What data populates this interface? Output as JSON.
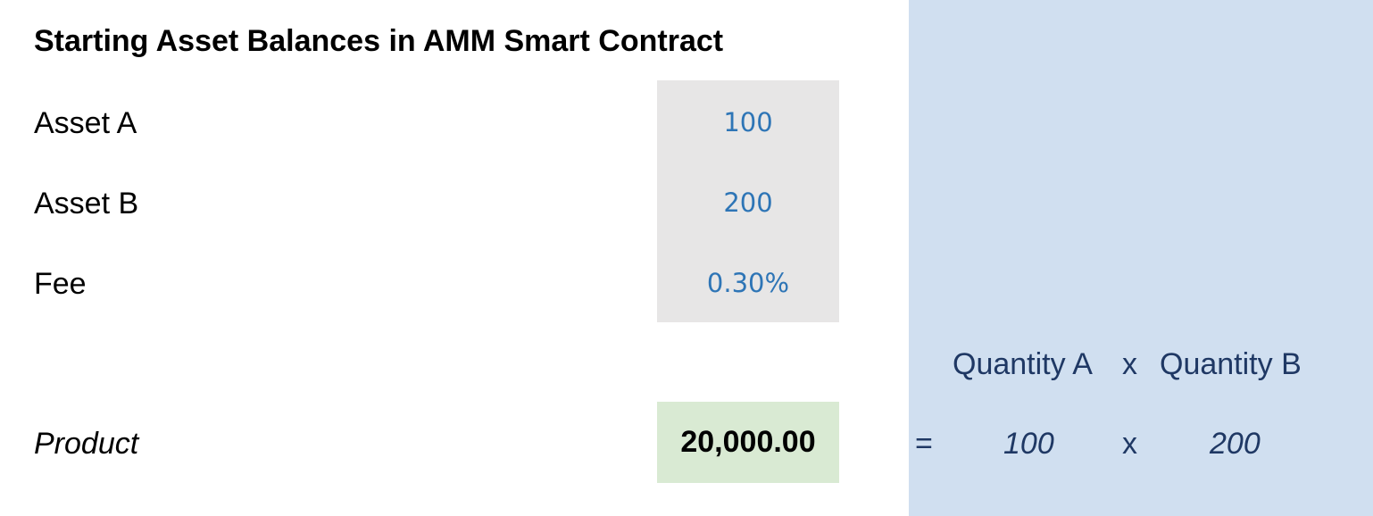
{
  "title": "Starting Asset Balances in AMM Smart Contract",
  "rows": [
    {
      "label": "Asset A",
      "value": "100"
    },
    {
      "label": "Asset B",
      "value": "200"
    },
    {
      "label": "Fee",
      "value": "0.30%"
    }
  ],
  "product": {
    "label": "Product",
    "value": "20,000.00"
  },
  "formula": {
    "header_a": "Quantity A",
    "header_op": "x",
    "header_b": "Quantity B",
    "equals": "=",
    "value_a": "100",
    "op": "x",
    "value_b": "200"
  },
  "colors": {
    "input_fill": "#e7e6e6",
    "input_text": "#2e75b6",
    "product_fill": "#d9ead3",
    "formula_fill": "#d0dff0",
    "formula_text": "#1f3864"
  }
}
